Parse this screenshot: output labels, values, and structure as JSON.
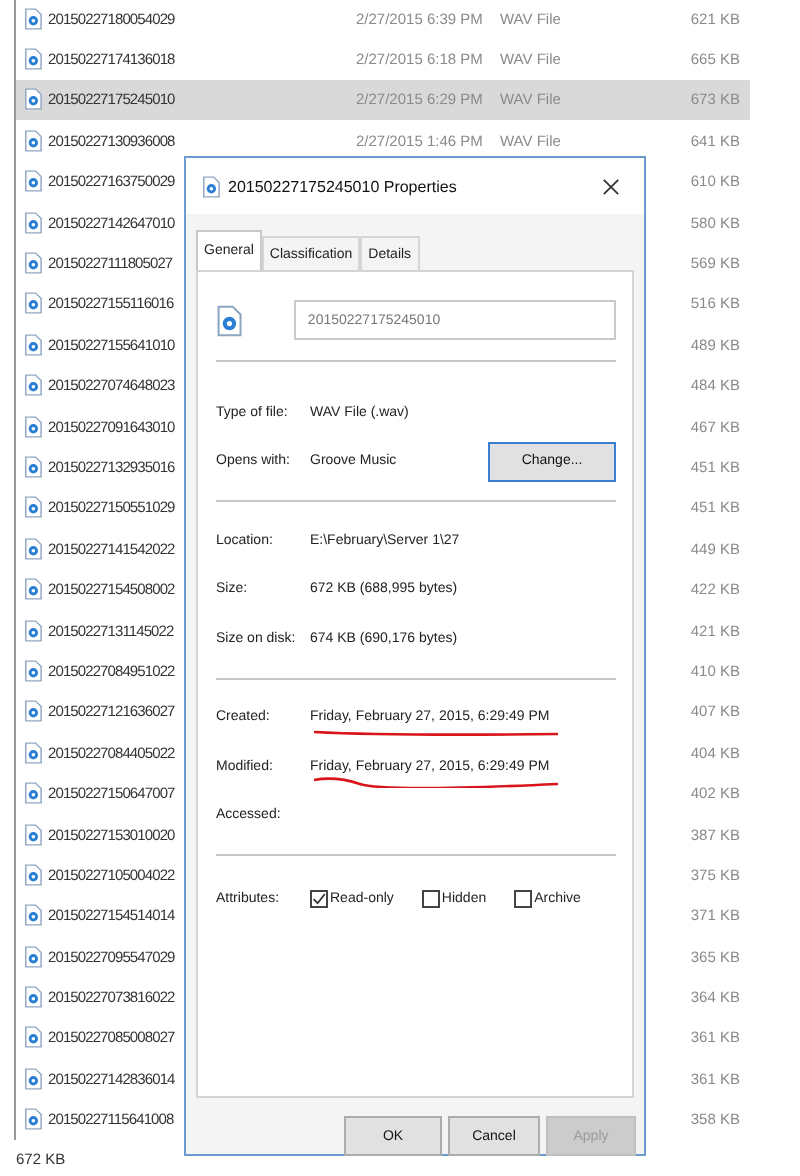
{
  "file_list": {
    "rows": [
      {
        "name": "20150227180054029",
        "date": "2/27/2015 6:39 PM",
        "type": "WAV File",
        "size": "621 KB",
        "selected": false
      },
      {
        "name": "20150227174136018",
        "date": "2/27/2015 6:18 PM",
        "type": "WAV File",
        "size": "665 KB",
        "selected": false
      },
      {
        "name": "20150227175245010",
        "date": "2/27/2015 6:29 PM",
        "type": "WAV File",
        "size": "673 KB",
        "selected": true
      },
      {
        "name": "20150227130936008",
        "date": "2/27/2015 1:46 PM",
        "type": "WAV File",
        "size": "641 KB",
        "selected": false
      },
      {
        "name": "20150227163750029",
        "size": "610 KB",
        "selected": false
      },
      {
        "name": "20150227142647010",
        "size": "580 KB",
        "selected": false
      },
      {
        "name": "20150227111805027",
        "size": "569 KB",
        "selected": false
      },
      {
        "name": "20150227155116016",
        "size": "516 KB",
        "selected": false
      },
      {
        "name": "20150227155641010",
        "size": "489 KB",
        "selected": false
      },
      {
        "name": "20150227074648023",
        "size": "484 KB",
        "selected": false
      },
      {
        "name": "20150227091643010",
        "size": "467 KB",
        "selected": false
      },
      {
        "name": "20150227132935016",
        "size": "451 KB",
        "selected": false
      },
      {
        "name": "20150227150551029",
        "size": "451 KB",
        "selected": false
      },
      {
        "name": "20150227141542022",
        "size": "449 KB",
        "selected": false
      },
      {
        "name": "20150227154508002",
        "size": "422 KB",
        "selected": false
      },
      {
        "name": "20150227131145022",
        "size": "421 KB",
        "selected": false
      },
      {
        "name": "20150227084951022",
        "size": "410 KB",
        "selected": false
      },
      {
        "name": "20150227121636027",
        "size": "407 KB",
        "selected": false
      },
      {
        "name": "20150227084405022",
        "size": "404 KB",
        "selected": false
      },
      {
        "name": "20150227150647007",
        "size": "402 KB",
        "selected": false
      },
      {
        "name": "20150227153010020",
        "size": "387 KB",
        "selected": false
      },
      {
        "name": "20150227105004022",
        "size": "375 KB",
        "selected": false
      },
      {
        "name": "20150227154514014",
        "size": "371 KB",
        "selected": false
      },
      {
        "name": "20150227095547029",
        "size": "365 KB",
        "selected": false
      },
      {
        "name": "20150227073816022",
        "size": "364 KB",
        "selected": false
      },
      {
        "name": "20150227085008027",
        "size": "361 KB",
        "selected": false
      },
      {
        "name": "20150227142836014",
        "size": "361 KB",
        "selected": false
      },
      {
        "name": "20150227115641008",
        "size": "358 KB",
        "selected": false
      }
    ]
  },
  "status_bar": {
    "text": "672 KB"
  },
  "dialog": {
    "title": "20150227175245010 Properties",
    "tabs": [
      {
        "label": "General",
        "selected": true
      },
      {
        "label": "Classification",
        "selected": false
      },
      {
        "label": "Details",
        "selected": false
      }
    ],
    "file_name": "20150227175245010",
    "sections": [
      [
        {
          "label": "Type of file:",
          "value": "WAV File (.wav)"
        },
        {
          "label": "Opens with:",
          "value": "Groove Music",
          "button": "Change..."
        }
      ],
      [
        {
          "label": "Location:",
          "value": "E:\\February\\Server 1\\27"
        },
        {
          "label": "Size:",
          "value": "672 KB (688,995 bytes)"
        },
        {
          "label": "Size on disk:",
          "value": "674 KB (690,176 bytes)"
        }
      ],
      [
        {
          "label": "Created:",
          "value": "Friday, February 27, 2015, 6:29:49 PM",
          "underlined": true
        },
        {
          "label": "Modified:",
          "value": "Friday, February 27, 2015, 6:29:49 PM",
          "underlined": true
        },
        {
          "label": "Accessed:"
        }
      ]
    ],
    "attributes": {
      "label": "Attributes:",
      "checkboxes": [
        {
          "label": "Read-only",
          "checked": true
        },
        {
          "label": "Hidden",
          "checked": false
        },
        {
          "label": "Archive",
          "checked": false
        }
      ]
    },
    "buttons": [
      {
        "label": "OK",
        "disabled": false
      },
      {
        "label": "Cancel",
        "disabled": false
      },
      {
        "label": "Apply",
        "disabled": true
      }
    ]
  }
}
